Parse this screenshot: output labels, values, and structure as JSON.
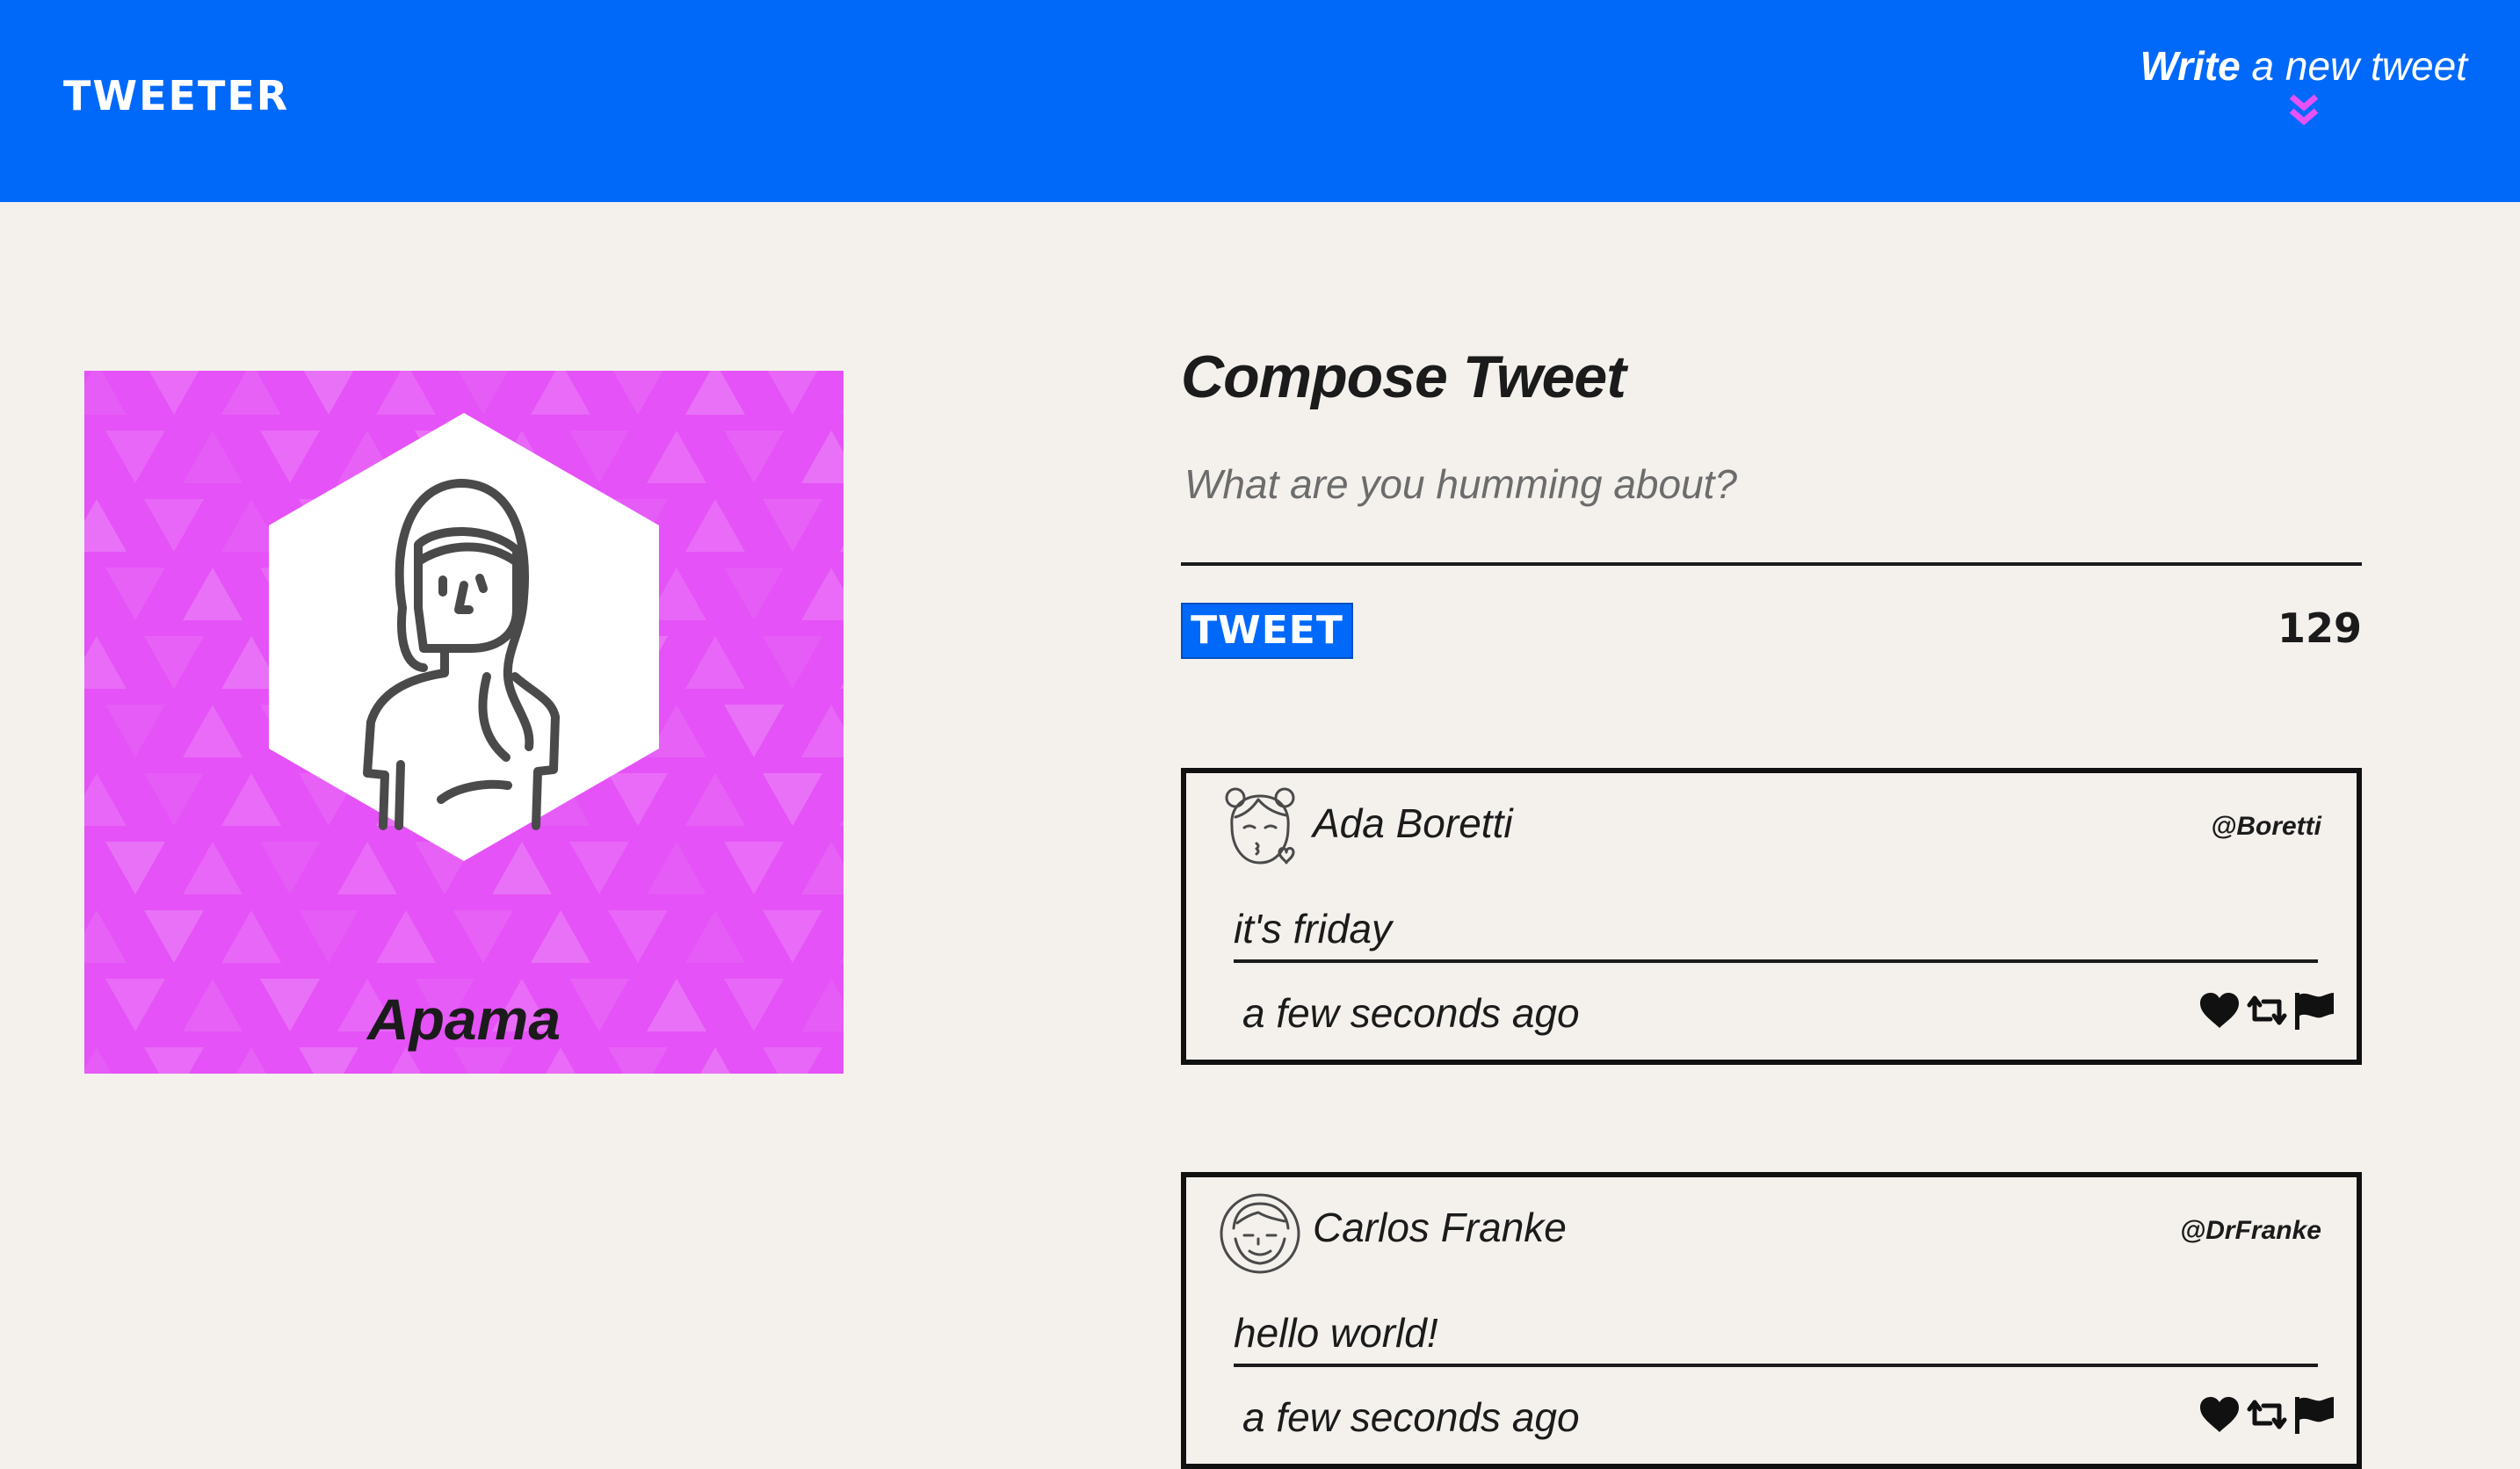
{
  "nav": {
    "brand": "TWEETER",
    "write_strong": "Write",
    "write_rest": " a new tweet",
    "toggle_icon": "double-chevron-down-icon"
  },
  "profile": {
    "name": "Apama",
    "avatar_icon": "woman-avatar-icon",
    "background_color": "#e552f7"
  },
  "compose": {
    "title": "Compose Tweet",
    "placeholder": "What are you humming about?",
    "value": "",
    "button_label": "TWEET",
    "counter": "129"
  },
  "tweets": [
    {
      "name": "Ada Boretti",
      "handle": "@Boretti",
      "content": "it's friday",
      "time": "a few seconds ago",
      "avatar_icon": "girl-kiss-avatar-icon"
    },
    {
      "name": "Carlos Franke",
      "handle": "@DrFranke",
      "content": "hello world!",
      "time": "a few seconds ago",
      "avatar_icon": "man-avatar-icon"
    }
  ],
  "colors": {
    "nav": "#0069fa",
    "page": "#f4f1ed",
    "accent": "#e552f7",
    "text": "#1b1b1b"
  }
}
